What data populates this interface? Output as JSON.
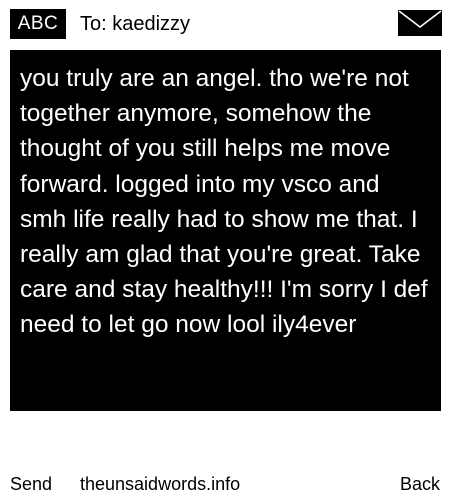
{
  "header": {
    "badge_label": "ABC",
    "to_label": "To: kaedizzy",
    "icon": "envelope-icon"
  },
  "message": {
    "text": "you truly are an angel. tho we're not together anymore, somehow the thought of you still helps me move forward. logged into my vsco and smh life really had to show me that. I really am glad that you're great. Take care and stay healthy!!! I'm sorry I def need to let go now lool ily4ever"
  },
  "footer": {
    "send_label": "Send",
    "site_label": "theunsaidwords.info",
    "back_label": "Back"
  },
  "colors": {
    "background": "#ffffff",
    "message_bg": "#000000",
    "message_text": "#ffffff"
  }
}
